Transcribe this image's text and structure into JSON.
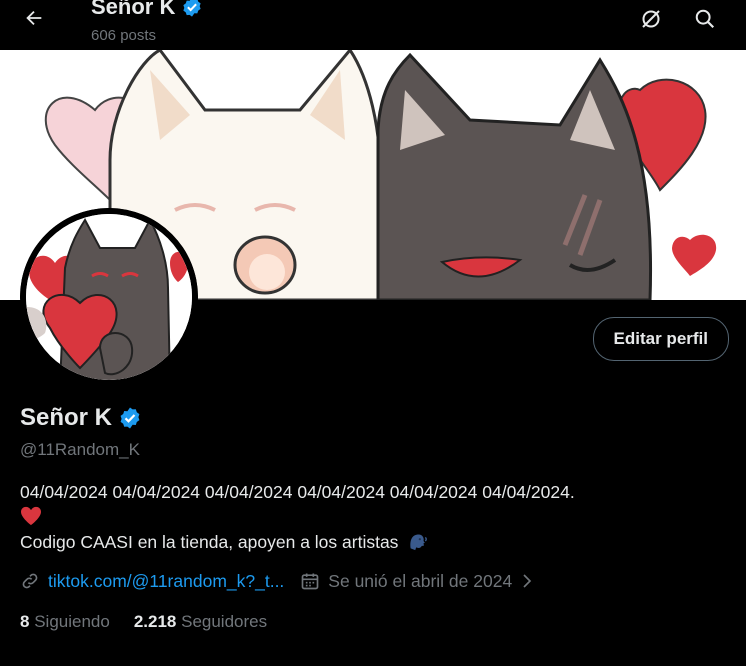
{
  "header": {
    "name": "Señor K",
    "posts": "606 posts"
  },
  "profile": {
    "display_name": "Señor K",
    "handle": "@11Random_K",
    "edit_button": "Editar perfil",
    "bio_line1": "04/04/2024 04/04/2024 04/04/2024 04/04/2024 04/04/2024 04/04/2024.",
    "bio_line2_emoji": "❤️",
    "bio_line3": "Codigo CAASI en la tienda, apoyen a los artistas",
    "bio_line3_emoji": "🗣️",
    "link": "tiktok.com/@11random_k?_t...",
    "joined": "Se unió el abril de 2024"
  },
  "stats": {
    "following_count": "8",
    "following_label": "Siguiendo",
    "followers_count": "2.218",
    "followers_label": "Seguidores"
  },
  "colors": {
    "accent": "#1d9bf0",
    "secondary_text": "#71767b",
    "primary_text": "#e7e9ea",
    "background": "#000000",
    "heart_red": "#d9363e"
  },
  "icons": {
    "back": "arrow-left-icon",
    "edit_profile_alt": "no-signal-icon",
    "search": "search-icon",
    "verified": "verified-badge-icon",
    "link": "link-icon",
    "calendar": "calendar-icon",
    "chevron": "chevron-right-icon"
  }
}
